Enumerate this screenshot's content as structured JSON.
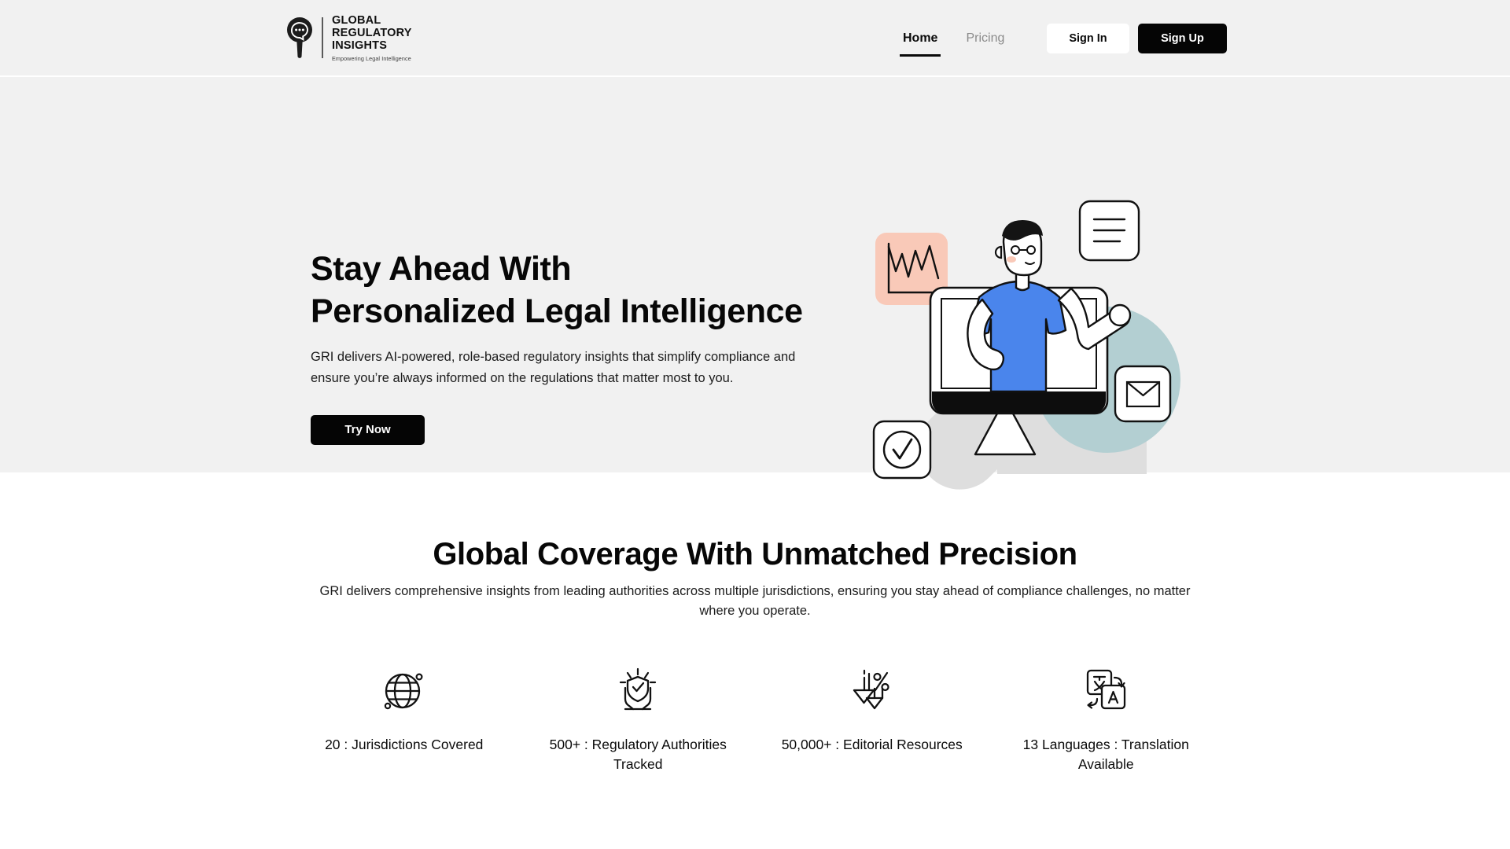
{
  "header": {
    "logo": {
      "icon": "magnifier-chat-logo-icon",
      "line1": "GLOBAL",
      "line2": "REGULATORY",
      "line3": "INSIGHTS",
      "tagline": "Empowering Legal Intelligence"
    },
    "nav": [
      {
        "label": "Home",
        "active": true
      },
      {
        "label": "Pricing",
        "active": false
      }
    ],
    "sign_in_label": "Sign In",
    "sign_up_label": "Sign Up"
  },
  "hero": {
    "title_line1": "Stay Ahead With",
    "title_line2": "Personalized Legal Intelligence",
    "description": "GRI delivers AI-powered, role-based regulatory insights that simplify compliance and ensure you’re always informed on the regulations that matter most to you.",
    "cta_label": "Try Now",
    "illustration": "person-at-monitor-illustration"
  },
  "features": {
    "title": "Global Coverage With Unmatched Precision",
    "subtitle": "GRI delivers comprehensive insights from leading authorities across multiple jurisdictions, ensuring you stay ahead of compliance challenges, no matter where you operate.",
    "stats": [
      {
        "icon": "globe-icon",
        "label": "20 : Jurisdictions Covered"
      },
      {
        "icon": "shield-hands-icon",
        "label": "500+ : Regulatory Authorities Tracked"
      },
      {
        "icon": "download-percent-icon",
        "label": "50,000+ : Editorial Resources"
      },
      {
        "icon": "translate-icon",
        "label": "13 Languages : Translation Available"
      }
    ]
  },
  "colors": {
    "page_bg": "#ffffff",
    "section_bg": "#f1f1f1",
    "accent_dark": "#050505",
    "muted_text": "#8b8b8b",
    "illustration_blue": "#4a85ec",
    "illustration_pink": "#f9c9b8",
    "illustration_teal": "#b3cfd2",
    "illustration_gray": "#dedede"
  }
}
